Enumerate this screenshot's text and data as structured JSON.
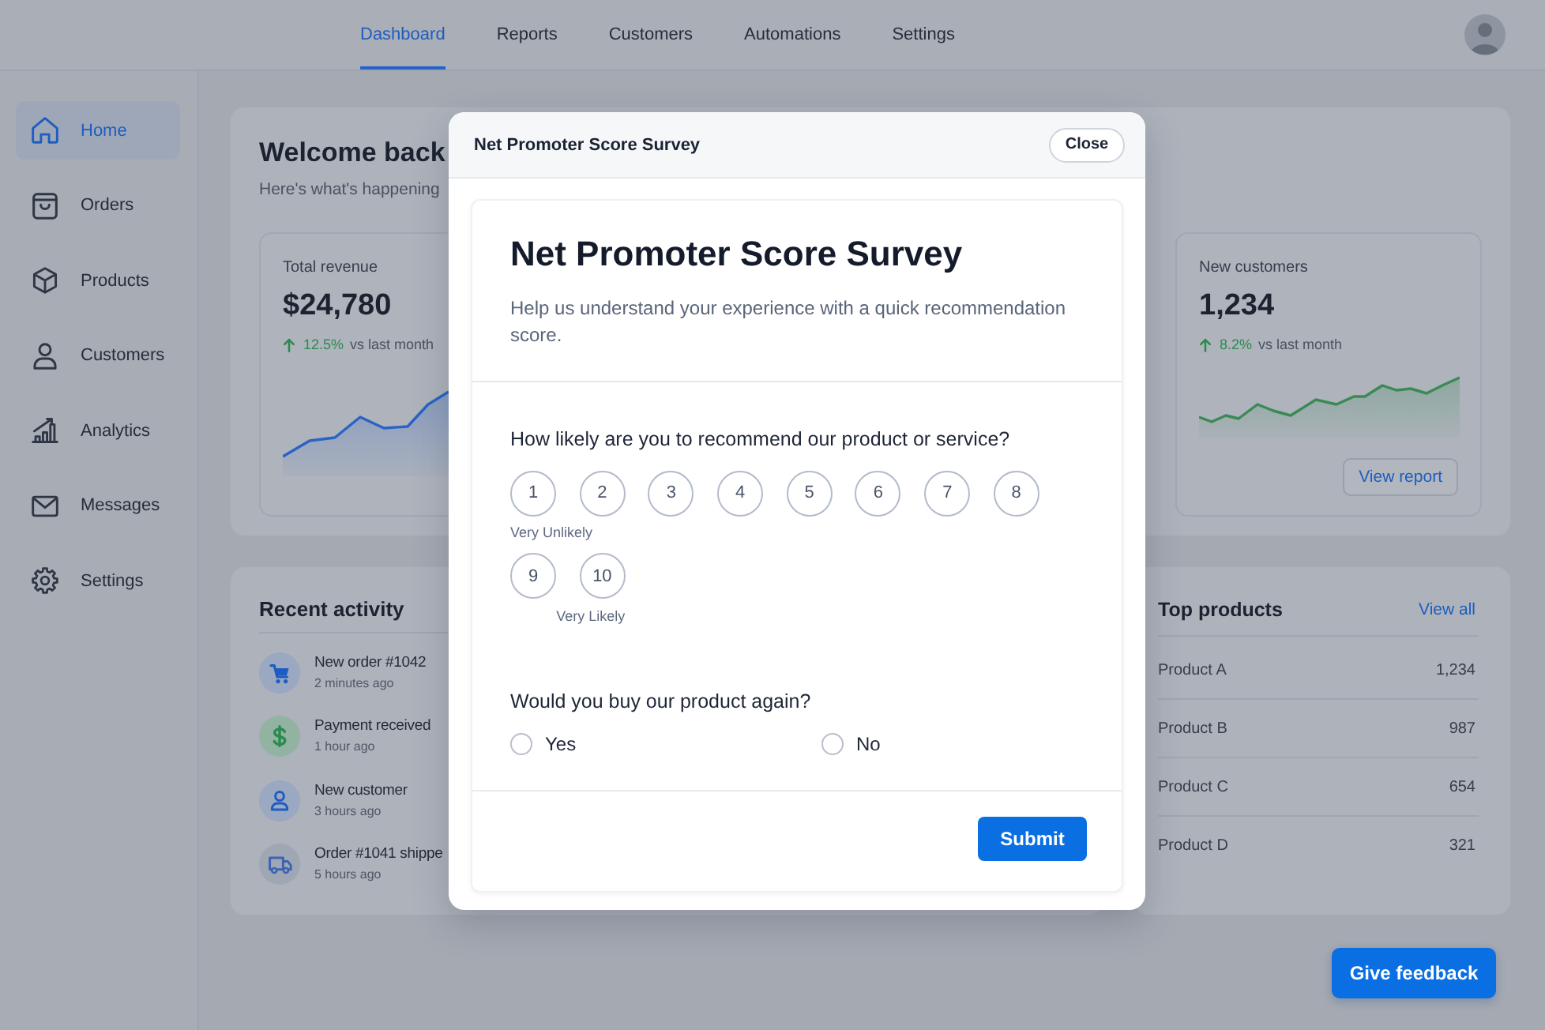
{
  "top_nav": {
    "tabs": [
      {
        "label": "Dashboard",
        "selected": true
      },
      {
        "label": "Reports",
        "selected": false
      },
      {
        "label": "Customers",
        "selected": false
      },
      {
        "label": "Automations",
        "selected": false
      },
      {
        "label": "Settings",
        "selected": false
      }
    ]
  },
  "sidebar": {
    "items": [
      {
        "label": "Home",
        "selected": true
      },
      {
        "label": "Orders",
        "selected": false
      },
      {
        "label": "Products",
        "selected": false
      },
      {
        "label": "Customers",
        "selected": false
      },
      {
        "label": "Analytics",
        "selected": false
      },
      {
        "label": "Messages",
        "selected": false
      },
      {
        "label": "Settings",
        "selected": false
      }
    ]
  },
  "welcome": {
    "title": "Welcome back",
    "subtitle": "Here's what's happening"
  },
  "stat_cards": [
    {
      "label": "Total revenue",
      "value": "$24,780",
      "change": "12.5%",
      "change_note": "vs last month",
      "color": "#2a63c6"
    },
    {
      "label": "New customers",
      "value": "1,234",
      "change": "8.2%",
      "change_note": "vs last month",
      "color": "#3a8a56",
      "button": "View report"
    }
  ],
  "recent_activity": {
    "title": "Recent activity",
    "items": [
      {
        "title": "New order #1042",
        "time": "2 minutes ago"
      },
      {
        "title": "Payment received",
        "time": "1 hour ago"
      },
      {
        "title": "New customer",
        "time": "3 hours ago"
      },
      {
        "title": "Order #1041 shippe",
        "time": "5 hours ago"
      }
    ]
  },
  "top_products": {
    "title": "Top products",
    "link": "View all",
    "rows": [
      {
        "name": "Product A",
        "value": "1,234"
      },
      {
        "name": "Product B",
        "value": "987"
      },
      {
        "name": "Product C",
        "value": "654"
      },
      {
        "name": "Product D",
        "value": "321"
      }
    ]
  },
  "survey": {
    "header_title": "Net Promoter Score Survey",
    "close": "Close",
    "title": "Net Promoter Score Survey",
    "description": "Help us understand your experience with a quick recommendation score.",
    "questions": [
      {
        "kind": "scale",
        "prompt": "How likely are you to recommend our product or service?",
        "options": [
          {
            "label": "1",
            "selected": false
          },
          {
            "label": "2",
            "selected": false
          },
          {
            "label": "3",
            "selected": false
          },
          {
            "label": "4",
            "selected": false
          },
          {
            "label": "5",
            "selected": false
          },
          {
            "label": "6",
            "selected": false
          },
          {
            "label": "7",
            "selected": false
          },
          {
            "label": "8",
            "selected": false
          },
          {
            "label": "9",
            "selected": false
          },
          {
            "label": "10",
            "selected": false
          }
        ],
        "low_label": "Very Unlikely",
        "high_label": "Very Likely"
      },
      {
        "kind": "choice",
        "prompt": "Would you buy our product again?",
        "options": [
          {
            "label": "Yes",
            "selected": false
          },
          {
            "label": "No",
            "selected": false
          }
        ]
      }
    ],
    "submit": "Submit"
  },
  "feedback_button": "Give feedback"
}
